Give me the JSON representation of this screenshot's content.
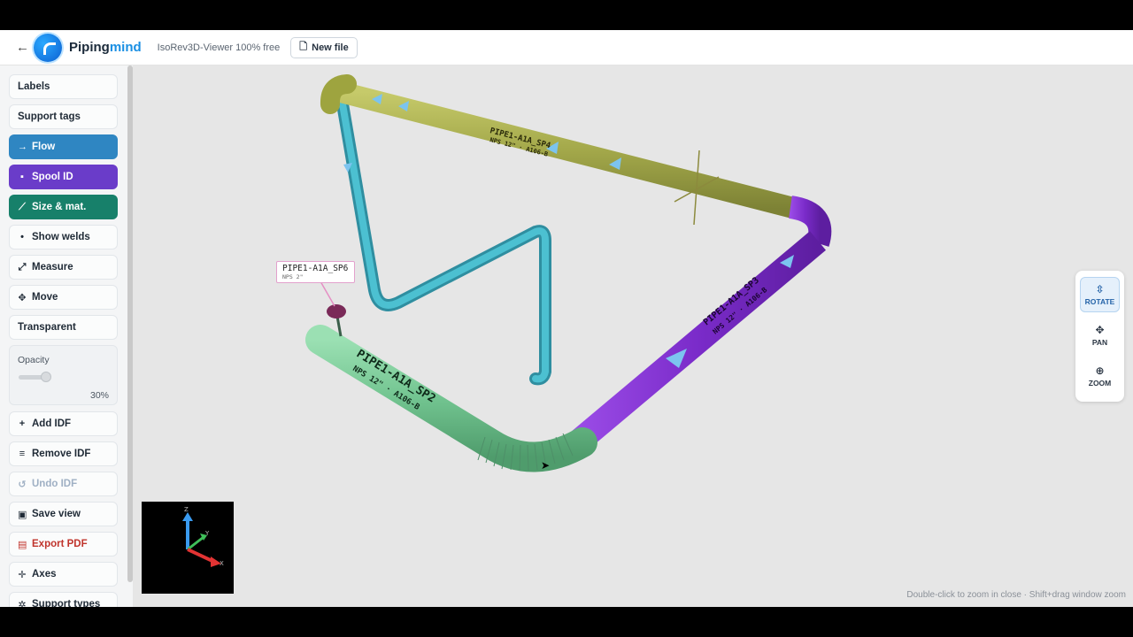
{
  "app": {
    "brand_main": "Piping",
    "brand_accent": "mind",
    "subtitle": "IsoRev3D-Viewer 100% free",
    "new_file_label": "New file"
  },
  "sidebar": {
    "labels": "Labels",
    "support_tags": "Support tags",
    "flow": "Flow",
    "spool_id": "Spool ID",
    "size_mat": "Size & mat.",
    "show_welds": "Show welds",
    "measure": "Measure",
    "move": "Move",
    "transparent": "Transparent",
    "opacity_label": "Opacity",
    "opacity_value": "30%",
    "opacity_fraction": 0.3,
    "add_idf": "Add IDF",
    "remove_idf": "Remove IDF",
    "undo_idf": "Undo IDF",
    "save_view": "Save view",
    "export_pdf": "Export PDF",
    "axes": "Axes",
    "support_types": "Support types"
  },
  "viewport": {
    "nav": {
      "rotate": "ROTATE",
      "pan": "PAN",
      "zoom": "ZOOM"
    },
    "hint": "Double-click to zoom in close · Shift+drag window zoom",
    "tag_label": {
      "name": "PIPE1-A1A_SP6",
      "sub": "NPS 2\""
    },
    "pipes": {
      "sp4_name": "PIPE1-A1A_SP4",
      "sp4_sub": "NPS 12\" · A106-B",
      "sp2_name": "PIPE1-A1A_SP2",
      "sp2_sub": "NPS 12\" · A106-B",
      "sp3_name": "PIPE1-A1A_SP3",
      "sp3_sub": "NPS 12\" · A106-B"
    },
    "gizmo": {
      "z": "Z",
      "y": "Y",
      "x": "X"
    },
    "colors": {
      "olive": "#a3a84a",
      "teal": "#3aa7b7",
      "green": "#72c490",
      "purple": "#7a2bc9",
      "flow_arrow": "#7cc4ef"
    }
  }
}
